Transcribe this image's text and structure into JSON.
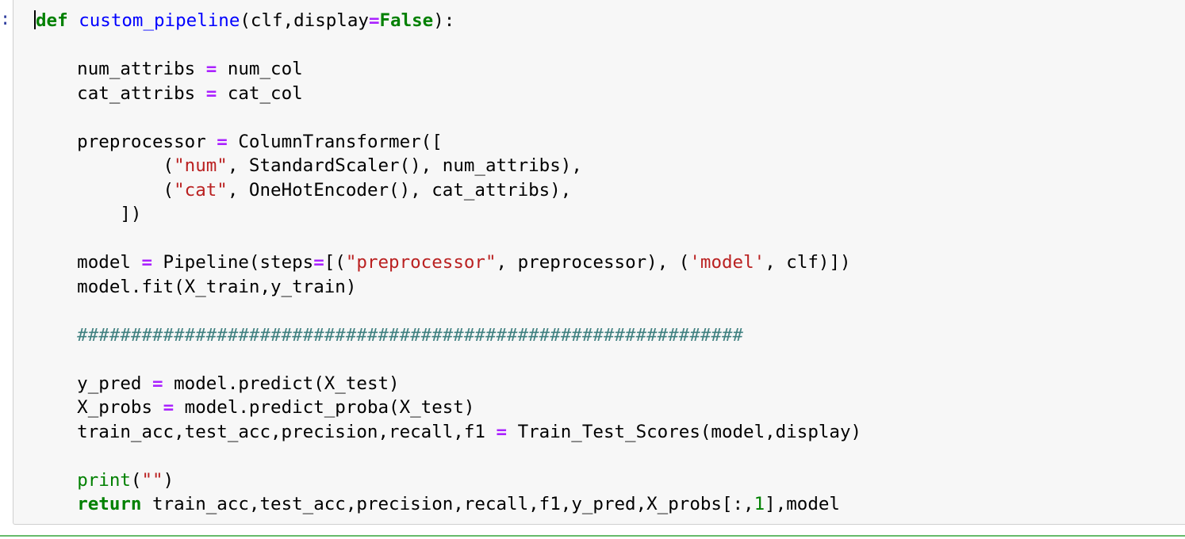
{
  "cell": {
    "prompt": ":",
    "lines": [
      [
        {
          "t": "def",
          "c": "kw"
        },
        {
          "t": " "
        },
        {
          "t": "custom_pipeline",
          "c": "fn"
        },
        {
          "t": "(clf,display"
        },
        {
          "t": "=",
          "c": "op"
        },
        {
          "t": "False",
          "c": "kw"
        },
        {
          "t": "):"
        }
      ],
      [],
      [
        {
          "t": "    num_attribs "
        },
        {
          "t": "=",
          "c": "op"
        },
        {
          "t": " num_col"
        }
      ],
      [
        {
          "t": "    cat_attribs "
        },
        {
          "t": "=",
          "c": "op"
        },
        {
          "t": " cat_col"
        }
      ],
      [],
      [
        {
          "t": "    preprocessor "
        },
        {
          "t": "=",
          "c": "op"
        },
        {
          "t": " ColumnTransformer(["
        }
      ],
      [
        {
          "t": "            ("
        },
        {
          "t": "\"num\"",
          "c": "str"
        },
        {
          "t": ", StandardScaler(), num_attribs),"
        }
      ],
      [
        {
          "t": "            ("
        },
        {
          "t": "\"cat\"",
          "c": "str"
        },
        {
          "t": ", OneHotEncoder(), cat_attribs),"
        }
      ],
      [
        {
          "t": "        ])"
        }
      ],
      [],
      [
        {
          "t": "    model "
        },
        {
          "t": "=",
          "c": "op"
        },
        {
          "t": " Pipeline(steps"
        },
        {
          "t": "=",
          "c": "op"
        },
        {
          "t": "[("
        },
        {
          "t": "\"preprocessor\"",
          "c": "str"
        },
        {
          "t": ", preprocessor), ("
        },
        {
          "t": "'model'",
          "c": "str"
        },
        {
          "t": ", clf)])"
        }
      ],
      [
        {
          "t": "    model.fit(X_train,y_train)"
        }
      ],
      [],
      [
        {
          "t": "    ##############################################################",
          "c": "cm"
        }
      ],
      [],
      [
        {
          "t": "    y_pred "
        },
        {
          "t": "=",
          "c": "op"
        },
        {
          "t": " model.predict(X_test)"
        }
      ],
      [
        {
          "t": "    X_probs "
        },
        {
          "t": "=",
          "c": "op"
        },
        {
          "t": " model.predict_proba(X_test)"
        }
      ],
      [
        {
          "t": "    train_acc,test_acc,precision,recall,f1 "
        },
        {
          "t": "=",
          "c": "op"
        },
        {
          "t": " Train_Test_Scores(model,display)"
        }
      ],
      [],
      [
        {
          "t": "    "
        },
        {
          "t": "print",
          "c": "bi"
        },
        {
          "t": "("
        },
        {
          "t": "\"\"",
          "c": "str"
        },
        {
          "t": ")"
        }
      ],
      [
        {
          "t": "    "
        },
        {
          "t": "return",
          "c": "kw"
        },
        {
          "t": " train_acc,test_acc,precision,recall,f1,y_pred,X_probs[:,"
        },
        {
          "t": "1",
          "c": "num"
        },
        {
          "t": "],model"
        }
      ]
    ]
  },
  "colors": {
    "keyword": "#008000",
    "function_name": "#0000ff",
    "operator": "#aa22ff",
    "string": "#ba2121",
    "comment": "#408080",
    "cell_background": "#f7f7f7",
    "selected_cell_border": "#66bb6a"
  }
}
